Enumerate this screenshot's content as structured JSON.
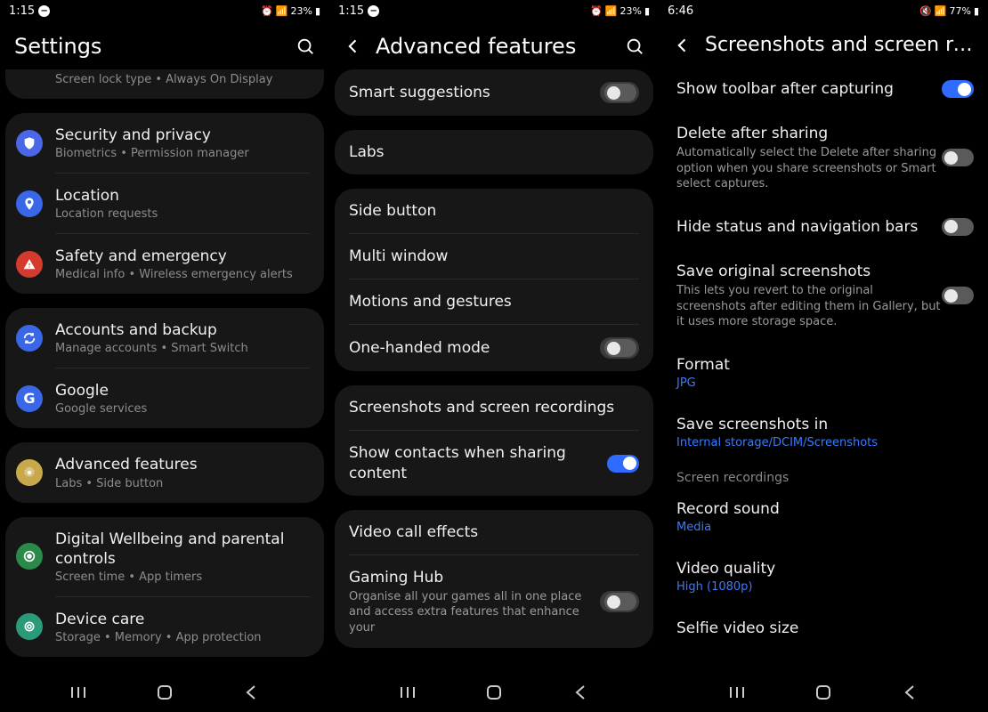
{
  "panel1": {
    "status": {
      "time": "1:15",
      "battery": "23%"
    },
    "title": "Settings",
    "partial_sub": "Screen lock type  •  Always On Display",
    "groups": [
      {
        "items": [
          {
            "icon": "shield",
            "color": "#4a67e8",
            "title": "Security and privacy",
            "sub": "Biometrics  •  Permission manager"
          },
          {
            "icon": "pin",
            "color": "#3a67e8",
            "title": "Location",
            "sub": "Location requests"
          },
          {
            "icon": "alert",
            "color": "#d53a2f",
            "title": "Safety and emergency",
            "sub": "Medical info  •  Wireless emergency alerts"
          }
        ]
      },
      {
        "items": [
          {
            "icon": "sync",
            "color": "#3a67e8",
            "title": "Accounts and backup",
            "sub": "Manage accounts  •  Smart Switch"
          },
          {
            "icon": "g",
            "color": "#3a67e8",
            "title": "Google",
            "sub": "Google services"
          }
        ]
      },
      {
        "items": [
          {
            "icon": "gear",
            "color": "#c8a84a",
            "title": "Advanced features",
            "sub": "Labs  •  Side button"
          }
        ]
      },
      {
        "items": [
          {
            "icon": "wellbeing",
            "color": "#2a8a4a",
            "title": "Digital Wellbeing and parental controls",
            "sub": "Screen time  •  App timers"
          },
          {
            "icon": "care",
            "color": "#2a9a7a",
            "title": "Device care",
            "sub": "Storage  •  Memory  •  App protection"
          }
        ]
      }
    ]
  },
  "panel2": {
    "status": {
      "time": "1:15",
      "battery": "23%"
    },
    "title": "Advanced features",
    "rows": [
      {
        "title": "Smart suggestions",
        "toggle": "off"
      },
      {
        "title": "Labs"
      },
      {
        "title": "Side button"
      },
      {
        "title": "Multi window"
      },
      {
        "title": "Motions and gestures"
      },
      {
        "title": "One-handed mode",
        "toggle": "off"
      },
      {
        "title": "Screenshots and screen recordings"
      },
      {
        "title": "Show contacts when sharing content",
        "toggle": "on"
      },
      {
        "title": "Video call effects"
      },
      {
        "title": "Gaming Hub",
        "sub": "Organise all your games all in one place and access extra features that enhance your",
        "toggle": "off"
      }
    ]
  },
  "panel3": {
    "status": {
      "time": "6:46",
      "battery": "77%"
    },
    "title": "Screenshots and screen recor...",
    "rows": [
      {
        "title": "Show toolbar after capturing",
        "toggle": "on"
      },
      {
        "title": "Delete after sharing",
        "desc": "Automatically select the Delete after sharing option when you share screenshots or Smart select captures.",
        "toggle": "off"
      },
      {
        "title": "Hide status and navigation bars",
        "toggle": "off"
      },
      {
        "title": "Save original screenshots",
        "desc": "This lets you revert to the original screenshots after editing them in Gallery, but it uses more storage space.",
        "toggle": "off"
      },
      {
        "title": "Format",
        "link": "JPG"
      },
      {
        "title": "Save screenshots in",
        "link": "Internal storage/DCIM/Screenshots"
      }
    ],
    "section": "Screen recordings",
    "rows2": [
      {
        "title": "Record sound",
        "link": "Media"
      },
      {
        "title": "Video quality",
        "link": "High (1080p)"
      },
      {
        "title": "Selfie video size"
      }
    ]
  }
}
